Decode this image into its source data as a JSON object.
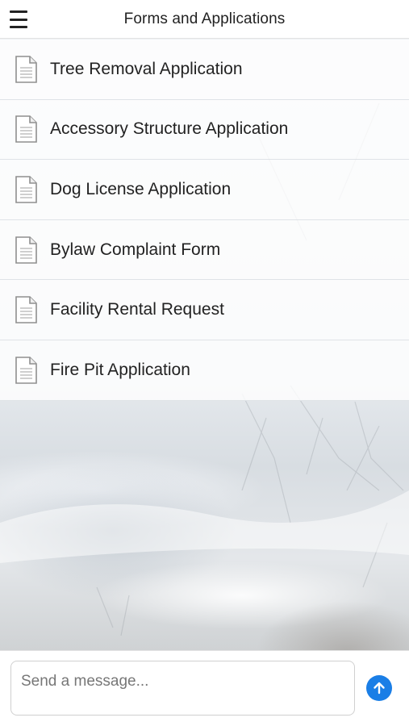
{
  "header": {
    "title": "Forms and Applications",
    "menu_icon": "hamburger-menu-icon"
  },
  "forms": [
    {
      "label": "Tree Removal Application",
      "icon": "document-icon"
    },
    {
      "label": "Accessory Structure Application",
      "icon": "document-icon"
    },
    {
      "label": "Dog License Application",
      "icon": "document-icon"
    },
    {
      "label": "Bylaw Complaint Form",
      "icon": "document-icon"
    },
    {
      "label": "Facility Rental Request",
      "icon": "document-icon"
    },
    {
      "label": "Fire Pit Application",
      "icon": "document-icon"
    }
  ],
  "composer": {
    "placeholder": "Send a message...",
    "value": "",
    "send_icon": "arrow-up-icon"
  },
  "colors": {
    "send_button": "#1a7ee6",
    "text": "#222222",
    "header_bg": "#ffffff"
  }
}
